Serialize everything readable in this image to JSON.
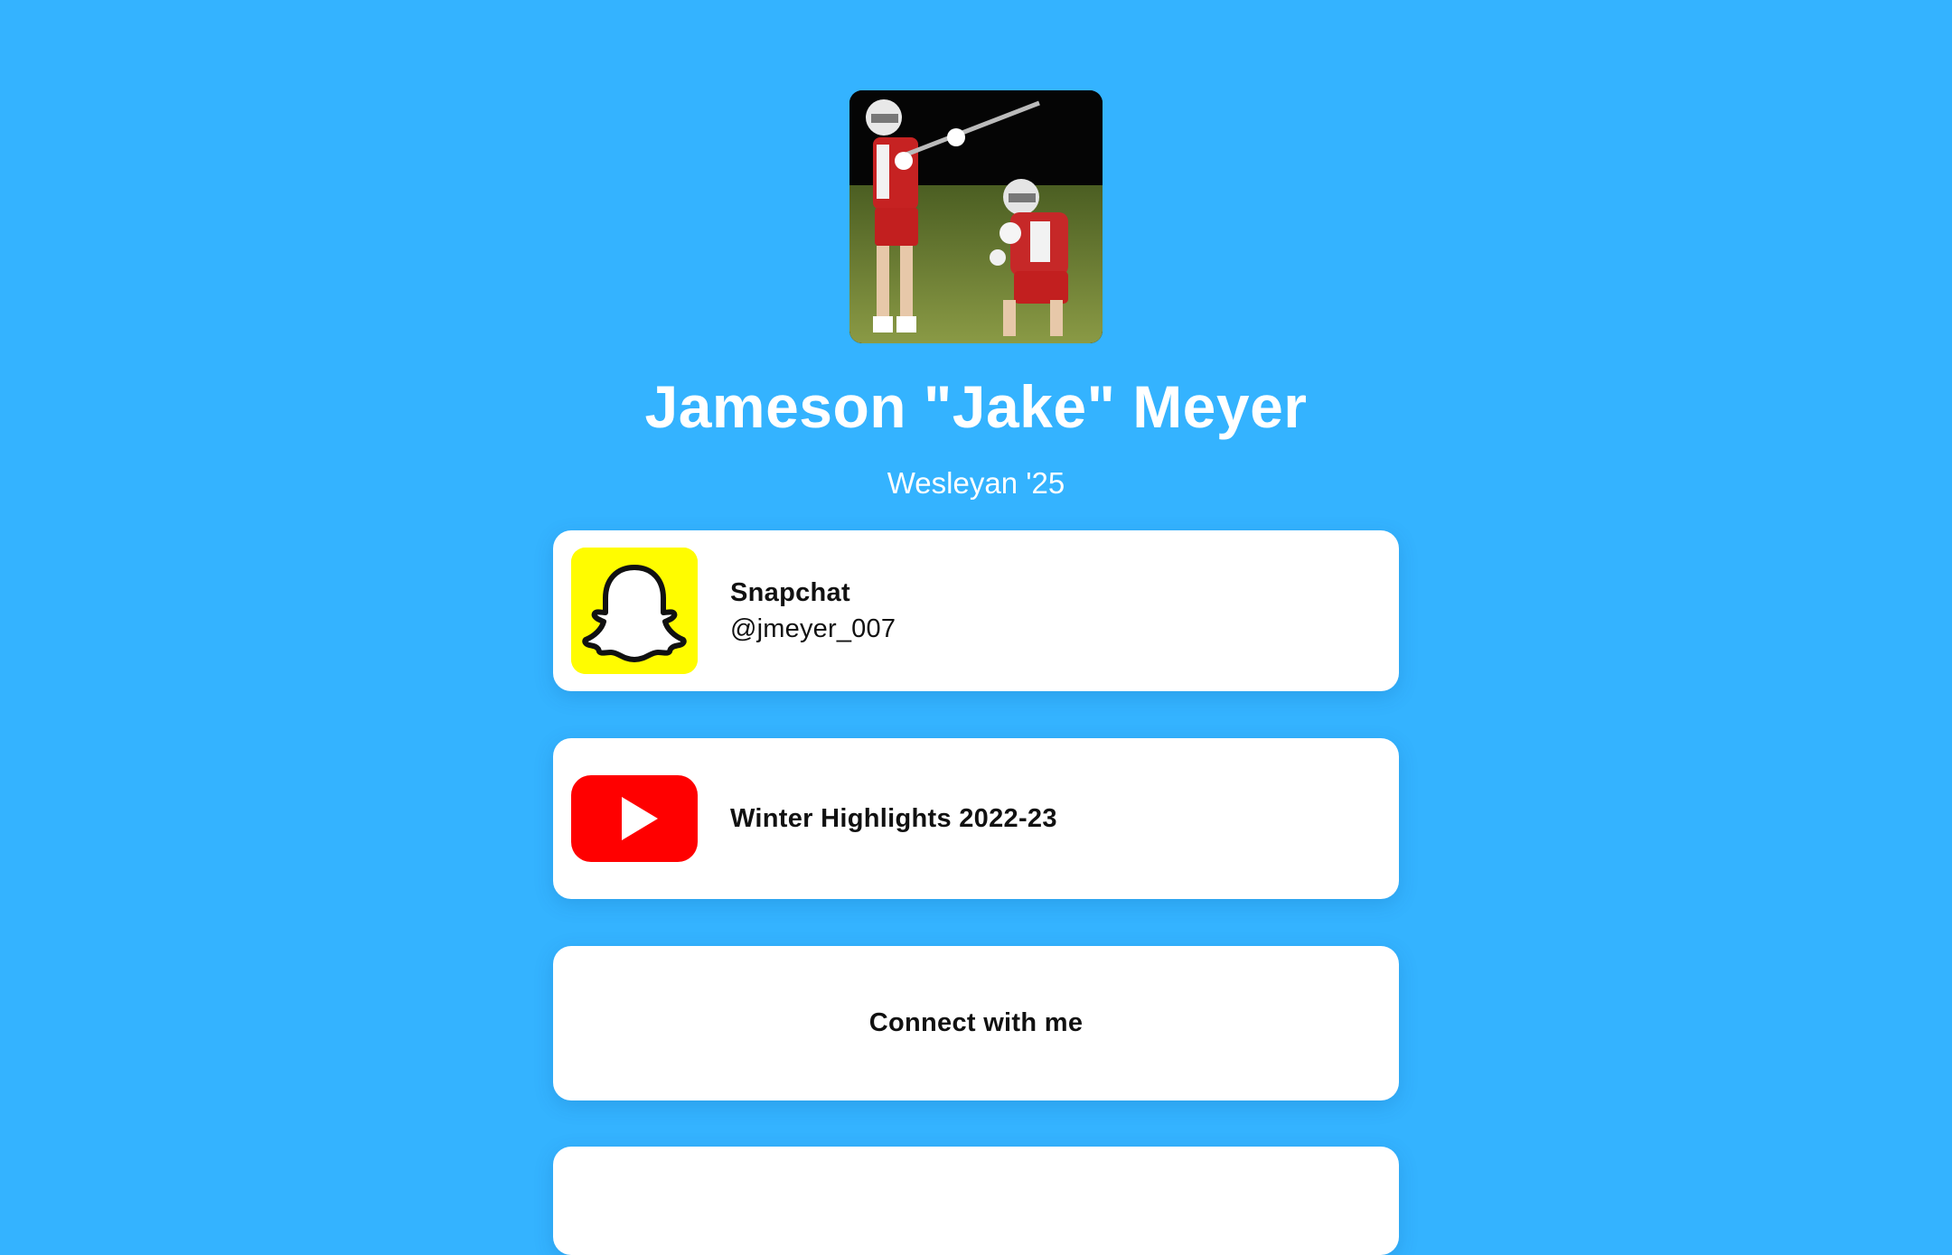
{
  "profile": {
    "name": "Jameson \"Jake\" Meyer",
    "subtitle": "Wesleyan '25",
    "avatar_icon": "lacrosse-players-photo"
  },
  "links": [
    {
      "icon": "snapchat-icon",
      "title": "Snapchat",
      "subtitle": "@jmeyer_007",
      "icon_bg": "#FFFC00"
    },
    {
      "icon": "youtube-icon",
      "title": "Winter Highlights 2022-23",
      "icon_bg": "#FF0000"
    },
    {
      "title": "Connect with me"
    }
  ],
  "colors": {
    "background": "#34B3FF",
    "card": "#FFFFFF",
    "text_dark": "#111111",
    "text_light": "#FFFFFF"
  }
}
